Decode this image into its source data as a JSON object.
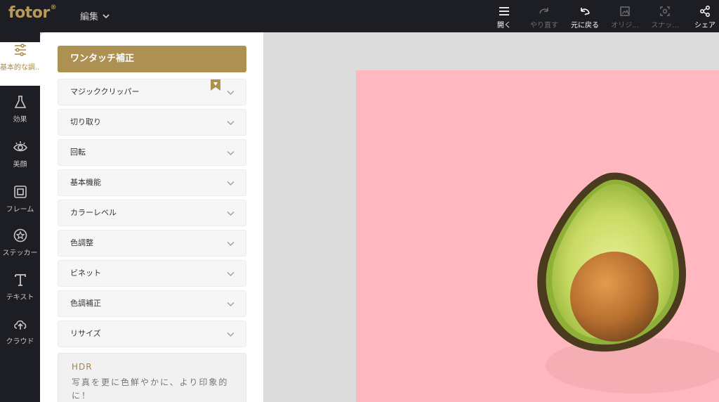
{
  "header": {
    "logo": "fotor",
    "logo_mark": "®",
    "edit_menu": "編集",
    "tools": [
      {
        "label": "開く",
        "icon": "menu-icon",
        "enabled": true
      },
      {
        "label": "やり直す",
        "icon": "redo-icon",
        "enabled": false
      },
      {
        "label": "元に戻る",
        "icon": "undo-icon",
        "enabled": true
      },
      {
        "label": "オリジ...",
        "icon": "image-icon",
        "enabled": false
      },
      {
        "label": "スナッ...",
        "icon": "snapshot-icon",
        "enabled": false
      },
      {
        "label": "シェア",
        "icon": "share-icon",
        "enabled": true
      }
    ]
  },
  "rail": {
    "items": [
      {
        "label": "基本的な調...",
        "icon": "sliders-icon",
        "active": true
      },
      {
        "label": "効果",
        "icon": "flask-icon",
        "active": false
      },
      {
        "label": "美顔",
        "icon": "eye-icon",
        "active": false
      },
      {
        "label": "フレーム",
        "icon": "frame-icon",
        "active": false
      },
      {
        "label": "ステッカー",
        "icon": "sticker-icon",
        "active": false
      },
      {
        "label": "テキスト",
        "icon": "text-icon",
        "active": false
      },
      {
        "label": "クラウド",
        "icon": "cloud-upload-icon",
        "active": false
      }
    ]
  },
  "panel": {
    "one_touch": "ワンタッチ補正",
    "sections": [
      "マジッククリッパー",
      "切り取り",
      "回転",
      "基本機能",
      "カラーレベル",
      "色調整",
      "ビネット",
      "色調補正",
      "リサイズ"
    ],
    "hdr": {
      "title": "HDR",
      "description": "写真を更に色鮮やかに、より印象的に！"
    }
  },
  "colors": {
    "accent": "#ad9152",
    "topbar": "#1d1e23",
    "photo_background": "#ffb8c0"
  }
}
